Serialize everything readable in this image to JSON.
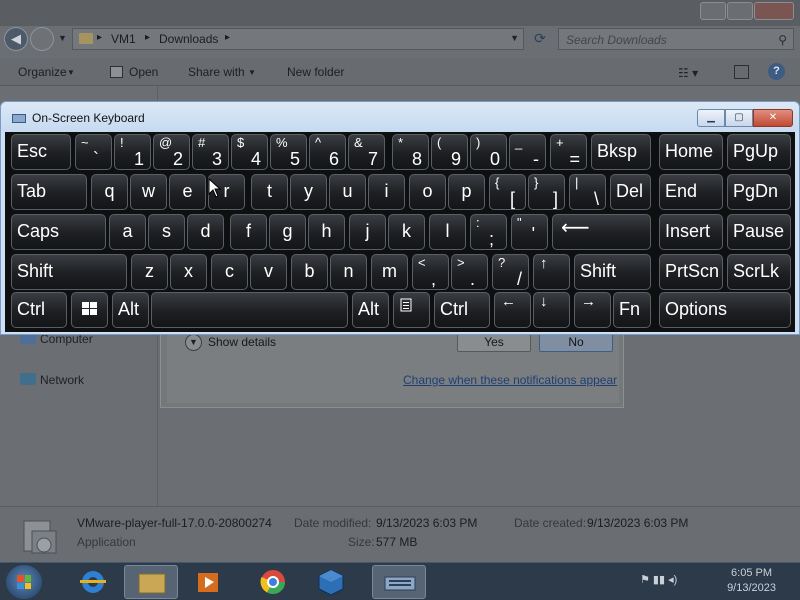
{
  "explorer": {
    "path": [
      "VM1",
      "Downloads"
    ],
    "search_placeholder": "Search Downloads",
    "toolbar": {
      "organize": "Organize",
      "open": "Open",
      "share_with": "Share with",
      "new_folder": "New folder"
    },
    "nav": {
      "computer": "Computer",
      "network": "Network"
    },
    "details": {
      "file_name": "VMware-player-full-17.0.0-20800274",
      "file_type": "Application",
      "date_modified_label": "Date modified:",
      "date_modified": "9/13/2023 6:03 PM",
      "date_created_label": "Date created:",
      "date_created": "9/13/2023 6:03 PM",
      "size_label": "Size:",
      "size": "577 MB"
    }
  },
  "dialog": {
    "show_details": "Show details",
    "yes": "Yes",
    "no": "No",
    "notifications_link": "Change when these notifications appear"
  },
  "osk": {
    "title": "On-Screen Keyboard",
    "keys": {
      "esc": "Esc",
      "bksp": "Bksp",
      "home": "Home",
      "pgup": "PgUp",
      "tab": "Tab",
      "del": "Del",
      "end": "End",
      "pgdn": "PgDn",
      "caps": "Caps",
      "insert": "Insert",
      "pause": "Pause",
      "shift": "Shift",
      "prtscn": "PrtScn",
      "scrlk": "ScrLk",
      "ctrl": "Ctrl",
      "alt": "Alt",
      "fn": "Fn",
      "options": "Options",
      "tilde_top": "~",
      "tilde_bot": "`",
      "n1_top": "!",
      "n1": "1",
      "n2_top": "@",
      "n2": "2",
      "n3_top": "#",
      "n3": "3",
      "n4_top": "$",
      "n4": "4",
      "n5_top": "%",
      "n5": "5",
      "n6_top": "^",
      "n6": "6",
      "n7_top": "&",
      "n7": "7",
      "n8_top": "*",
      "n8": "8",
      "n9_top": "(",
      "n9": "9",
      "n0_top": ")",
      "n0": "0",
      "minus_top": "_",
      "minus": "-",
      "plus_top": "+",
      "plus": "=",
      "q": "q",
      "w": "w",
      "e": "e",
      "r": "r",
      "t": "t",
      "y": "y",
      "u": "u",
      "i": "i",
      "o": "o",
      "p": "p",
      "lbrace_top": "{",
      "lbrace": "[",
      "rbrace_top": "}",
      "rbrace": "]",
      "pipe_top": "|",
      "pipe": "\\",
      "a": "a",
      "s": "s",
      "d": "d",
      "f": "f",
      "g": "g",
      "h": "h",
      "j": "j",
      "k": "k",
      "l": "l",
      "colon_top": ":",
      "colon": ";",
      "quote_top": "\"",
      "quote": "'",
      "z": "z",
      "x": "x",
      "c": "c",
      "v": "v",
      "b": "b",
      "n": "n",
      "m": "m",
      "lt_top": "<",
      "lt": ",",
      "gt_top": ">",
      "gt": ".",
      "q_top": "?",
      "slash": "/",
      "up": "↑",
      "left": "←",
      "down": "↓",
      "right": "→",
      "enter": "⟵"
    }
  },
  "taskbar": {
    "time": "6:05 PM",
    "date": "9/13/2023"
  }
}
